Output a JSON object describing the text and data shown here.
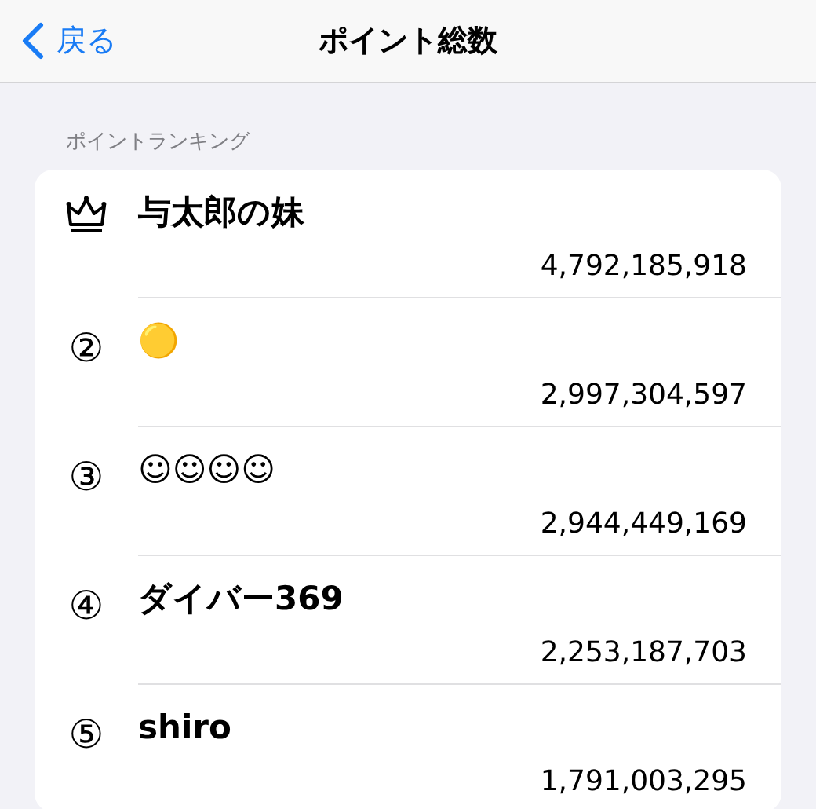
{
  "nav_bar": {
    "back_label": "戻る",
    "title": "ポイント総数"
  },
  "section_header": "ポイントランキング",
  "ranking": [
    {
      "kind": "crown",
      "name": "与太郎の妹",
      "points": "4,792,185,918"
    },
    {
      "kind": "number",
      "rank": "②",
      "name": "🟡",
      "points": "2,997,304,597"
    },
    {
      "kind": "number",
      "rank": "③",
      "name": "☺☺☺☺",
      "points": "2,944,449,169"
    },
    {
      "kind": "number",
      "rank": "④",
      "name": "ダイバー369",
      "points": "2,253,187,703"
    },
    {
      "kind": "number",
      "rank": "⑤",
      "name": "shiro",
      "points": "1,791,003,295"
    }
  ]
}
